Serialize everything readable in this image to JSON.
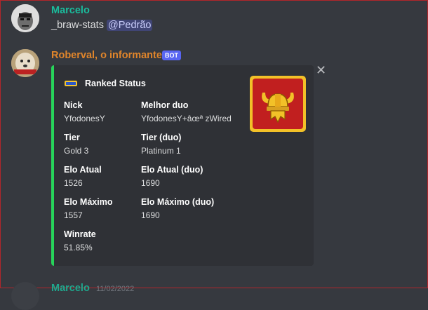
{
  "messages": [
    {
      "author": "Marcelo",
      "text": "_braw-stats",
      "mention": "@Pedrão"
    },
    {
      "author": "Roberval, o informante",
      "badge": "BOT"
    },
    {
      "author": "Marcelo",
      "time": "11/02/2022"
    }
  ],
  "embed": {
    "author_name": "Ranked Status",
    "fields": [
      {
        "name": "Nick",
        "value": "YfodonesY"
      },
      {
        "name": "Melhor duo",
        "value": "YfodonesY+âœª zWired"
      },
      {
        "name": "Tier",
        "value": "Gold 3"
      },
      {
        "name": "Tier (duo)",
        "value": "Platinum 1"
      },
      {
        "name": "Elo Atual",
        "value": "1526"
      },
      {
        "name": "Elo Atual (duo)",
        "value": "1690"
      },
      {
        "name": "Elo Máximo",
        "value": "1557"
      },
      {
        "name": "Elo Máximo (duo)",
        "value": "1690"
      },
      {
        "name": "Winrate",
        "value": "51.85%"
      }
    ],
    "accent_color": "#27d35a",
    "thumbnail_icon": "viking-helmet-icon"
  },
  "close_icon": "close-icon",
  "colors": {
    "background": "#36393f",
    "embed_bg": "#2f3136",
    "username_teal": "#1abc9c",
    "username_orange": "#e0852b"
  }
}
